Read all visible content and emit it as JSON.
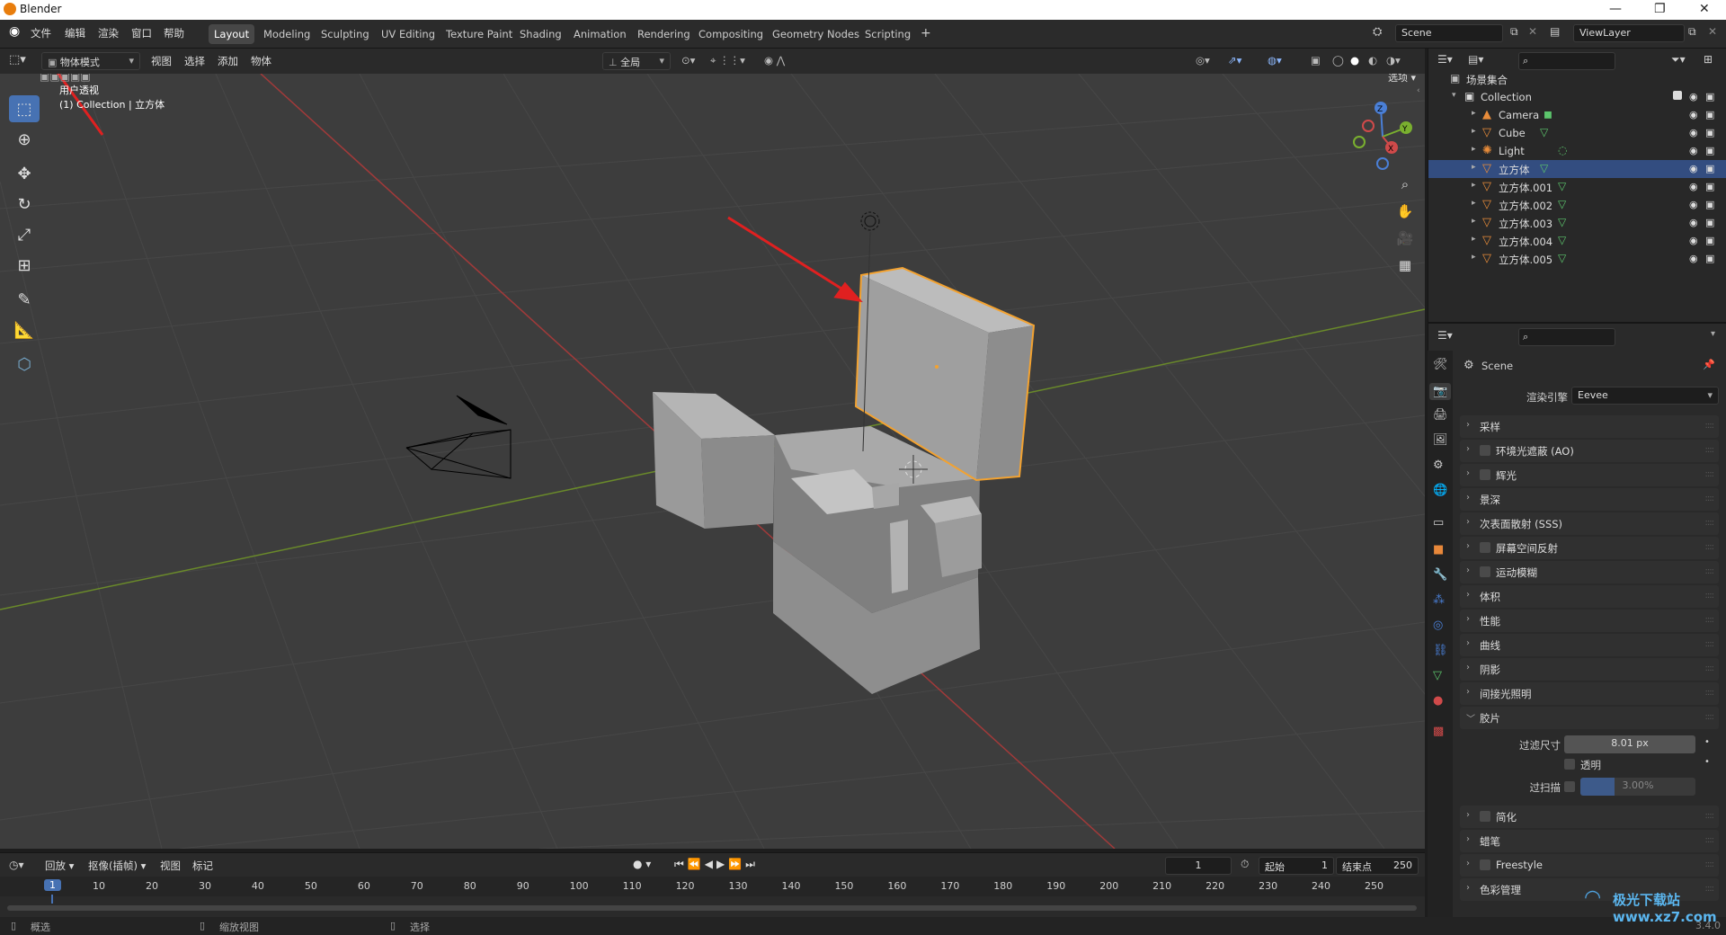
{
  "window": {
    "title": "Blender"
  },
  "menu": [
    "文件",
    "编辑",
    "渲染",
    "窗口",
    "帮助"
  ],
  "workspaces": [
    "Layout",
    "Modeling",
    "Sculpting",
    "UV Editing",
    "Texture Paint",
    "Shading",
    "Animation",
    "Rendering",
    "Compositing",
    "Geometry Nodes",
    "Scripting"
  ],
  "workspace_add": "+",
  "scene_field": "Scene",
  "viewlayer_field": "ViewLayer",
  "viewport_header": {
    "mode": "物体模式",
    "menus": [
      "视图",
      "选择",
      "添加",
      "物体"
    ],
    "orientation": "全局",
    "options": "选项"
  },
  "viewport_overlay": {
    "view_name": "用户透视",
    "collection_info": "(1) Collection | 立方体"
  },
  "gizmo": {
    "z": "Z",
    "y": "Y",
    "x": "X"
  },
  "outliner": {
    "root": "场景集合",
    "collection": "Collection",
    "items": [
      {
        "name": "Camera",
        "type": "camera",
        "selected": false
      },
      {
        "name": "Cube",
        "type": "mesh",
        "selected": false
      },
      {
        "name": "Light",
        "type": "light",
        "selected": false
      },
      {
        "name": "立方体",
        "type": "mesh",
        "selected": true
      },
      {
        "name": "立方体.001",
        "type": "mesh",
        "selected": false
      },
      {
        "name": "立方体.002",
        "type": "mesh",
        "selected": false
      },
      {
        "name": "立方体.003",
        "type": "mesh",
        "selected": false
      },
      {
        "name": "立方体.004",
        "type": "mesh",
        "selected": false
      },
      {
        "name": "立方体.005",
        "type": "mesh",
        "selected": false
      }
    ]
  },
  "properties": {
    "scene_name": "Scene",
    "render_engine_label": "渲染引擎",
    "render_engine_value": "Eevee",
    "panels": [
      {
        "label": "采样",
        "checkbox": false,
        "open": false
      },
      {
        "label": "环境光遮蔽 (AO)",
        "checkbox": true,
        "open": false
      },
      {
        "label": "辉光",
        "checkbox": true,
        "open": false
      },
      {
        "label": "景深",
        "checkbox": false,
        "open": false
      },
      {
        "label": "次表面散射 (SSS)",
        "checkbox": false,
        "open": false
      },
      {
        "label": "屏幕空间反射",
        "checkbox": true,
        "open": false
      },
      {
        "label": "运动模糊",
        "checkbox": true,
        "open": false
      },
      {
        "label": "体积",
        "checkbox": false,
        "open": false
      },
      {
        "label": "性能",
        "checkbox": false,
        "open": false
      },
      {
        "label": "曲线",
        "checkbox": false,
        "open": false
      },
      {
        "label": "阴影",
        "checkbox": false,
        "open": false
      },
      {
        "label": "间接光照明",
        "checkbox": false,
        "open": false
      },
      {
        "label": "胶片",
        "checkbox": false,
        "open": true
      }
    ],
    "film": {
      "filter_size_label": "过滤尺寸",
      "filter_size_value": "8.01 px",
      "transparent_label": "透明",
      "overscan_label": "过扫描",
      "overscan_value": "3.00%",
      "overscan_fraction": 0.3
    },
    "panels_after": [
      {
        "label": "简化",
        "checkbox": true
      },
      {
        "label": "蜡笔",
        "checkbox": false
      },
      {
        "label": "Freestyle",
        "checkbox": true
      },
      {
        "label": "色彩管理",
        "checkbox": false
      }
    ]
  },
  "timeline": {
    "menus": [
      "回放",
      "抠像(插帧)",
      "视图",
      "标记"
    ],
    "current_frame": "1",
    "start_label": "起始",
    "start_value": "1",
    "end_label": "结束点",
    "end_value": "250",
    "ruler": [
      "1",
      "10",
      "20",
      "30",
      "40",
      "50",
      "60",
      "70",
      "80",
      "90",
      "100",
      "110",
      "120",
      "130",
      "140",
      "150",
      "160",
      "170",
      "180",
      "190",
      "200",
      "210",
      "220",
      "230",
      "240",
      "250"
    ]
  },
  "statusbar": {
    "items": [
      "概选",
      "缩放视图",
      "选择"
    ],
    "version": "3.4.0"
  },
  "watermark": "极光下载站 www.xz7.com",
  "colors": {
    "accent": "#4772b3",
    "selection": "#f3a230",
    "arrow": "#e02020"
  }
}
